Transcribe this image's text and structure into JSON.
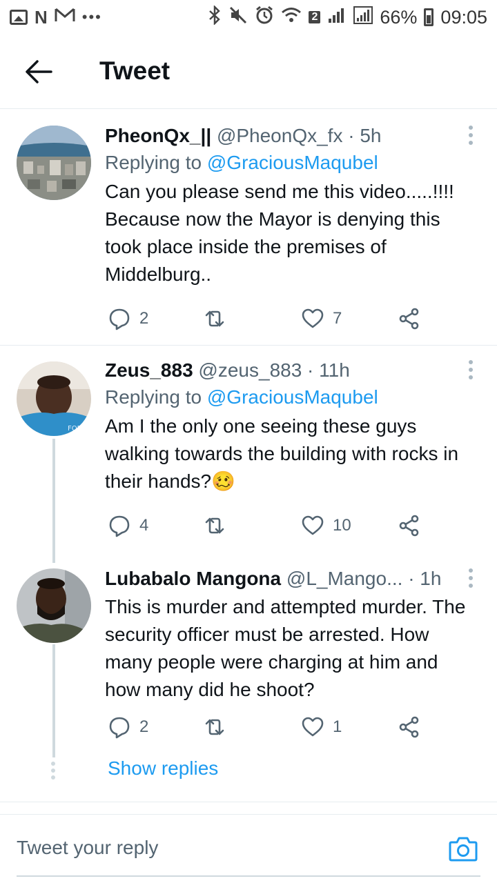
{
  "status_bar": {
    "left_icons": [
      "gallery-icon",
      "n-app-icon",
      "gmail-icon",
      "more-icon"
    ],
    "right_icons": [
      "bluetooth-icon",
      "mute-icon",
      "alarm-icon",
      "wifi-icon",
      "sim-icon",
      "signal-icon",
      "signal-icon",
      "battery-icon"
    ],
    "sim_badge": "2",
    "battery": "66%",
    "time": "09:05"
  },
  "header": {
    "title": "Tweet"
  },
  "tweets": [
    {
      "name": "PheonQx_||",
      "meta": "@PheonQx_fx · 5h",
      "replying_prefix": "Replying to ",
      "replying_to": "@GraciousMaqubel",
      "body": "Can you please send me this video.....!!!! Because now the Mayor is denying this took place inside the premises of Middelburg..",
      "replies": "2",
      "retweets": "",
      "likes": "7"
    },
    {
      "name": "Zeus_883",
      "meta": "@zeus_883 · 11h",
      "replying_prefix": "Replying to ",
      "replying_to": "@GraciousMaqubel",
      "body": "Am I the only one seeing these guys walking towards the building with rocks in their hands?🥴",
      "replies": "4",
      "retweets": "",
      "likes": "10"
    },
    {
      "name": "Lubabalo Mangona",
      "meta": "@L_Mango... · 1h",
      "body": "This is murder and attempted murder. The security officer must be arrested. How many people were charging at him and how many did he shoot?",
      "replies": "2",
      "retweets": "",
      "likes": "1"
    }
  ],
  "show_replies": "Show replies",
  "reply_bar": {
    "placeholder": "Tweet your reply"
  },
  "colors": {
    "accent": "#1d9bf0",
    "text": "#0f1419",
    "muted": "#536471",
    "divider": "#e6ecf0"
  }
}
